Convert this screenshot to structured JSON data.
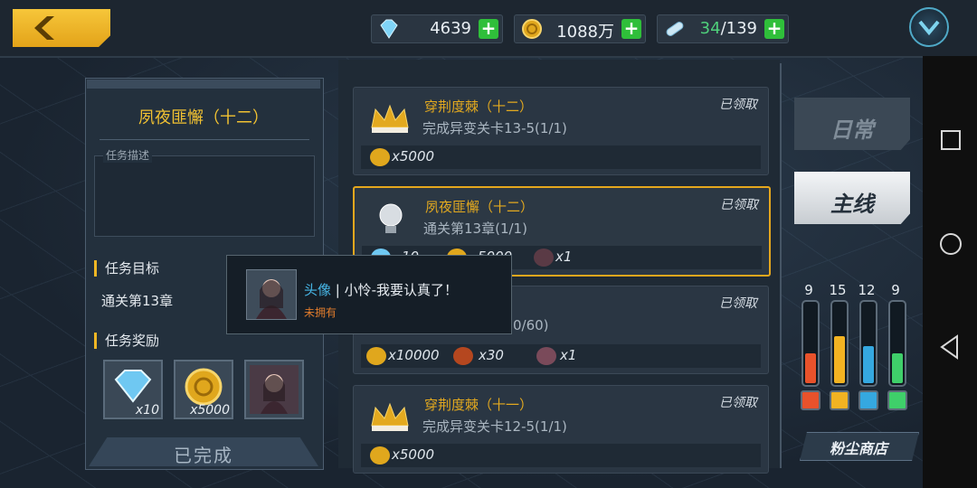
{
  "colors": {
    "accent": "#f0b624",
    "gem": "#5fc3f0",
    "coin": "#e0a71d",
    "plus": "#2fbf3a"
  },
  "top": {
    "crystals": "4639",
    "coins": "1088万",
    "stamina_current": "34",
    "stamina_max": "/139"
  },
  "mission": {
    "title": "夙夜匪懈（十二）",
    "desc_label": "任务描述",
    "goal_header": "任务目标",
    "goal_text": "通关第13章",
    "reward_header": "任务奖励",
    "rewards": [
      {
        "icon": "crystal-icon",
        "count": "x10"
      },
      {
        "icon": "coin-icon",
        "count": "x5000"
      },
      {
        "icon": "avatar-icon",
        "count": ""
      }
    ],
    "done_label": "已完成"
  },
  "quests": [
    {
      "title": "穿荆度棘（十二）",
      "sub": "完成异变关卡13-5(1/1)",
      "status": "已领取",
      "rewards": [
        "x5000"
      ]
    },
    {
      "title": "夙夜匪懈（十二）",
      "sub": "通关第13章(1/1)",
      "status": "已领取",
      "rewards": [
        "10",
        "5000",
        "x1"
      ]
    },
    {
      "title": "",
      "sub": "0/60)",
      "status": "已领取",
      "rewards": [
        "x10000",
        "x30",
        "x1"
      ]
    },
    {
      "title": "穿荆度棘（十一）",
      "sub": "完成异变关卡12-5(1/1)",
      "status": "已领取",
      "rewards": [
        "x5000"
      ]
    }
  ],
  "tabs": {
    "daily": "日常",
    "main": "主线"
  },
  "vials": [
    {
      "value": "9",
      "color": "#e8522b",
      "level": 0.38
    },
    {
      "value": "15",
      "color": "#f2b322",
      "level": 0.6
    },
    {
      "value": "12",
      "color": "#35a8e0",
      "level": 0.48
    },
    {
      "value": "9",
      "color": "#3fcf6a",
      "level": 0.38
    }
  ],
  "shop_label": "粉尘商店",
  "tooltip": {
    "kind": "头像",
    "sep": " | ",
    "name": "小怜-我要认真了！",
    "owned": "未拥有"
  }
}
